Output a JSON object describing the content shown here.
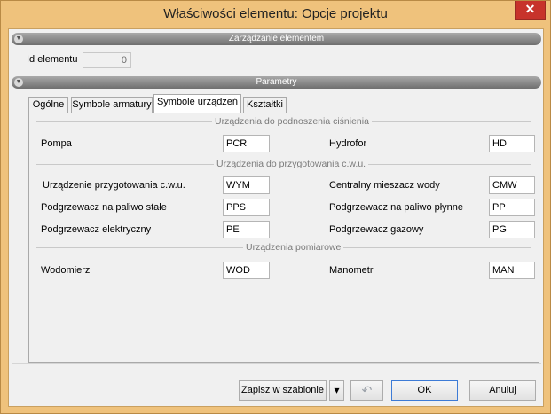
{
  "window": {
    "title": "Właściwości elementu: Opcje projektu",
    "close_label": "✕"
  },
  "sections": {
    "management": "Zarządzanie elementem",
    "parameters": "Parametry"
  },
  "element_id": {
    "label": "Id elementu",
    "value": "0"
  },
  "tabs": [
    {
      "label": "Ogólne"
    },
    {
      "label": "Symbole armatury"
    },
    {
      "label": "Symbole urządzeń"
    },
    {
      "label": "Kształtki"
    }
  ],
  "groups": {
    "pressure": {
      "title": "Urządzenia do podnoszenia ciśnienia",
      "rows": [
        {
          "left_label": "Pompa",
          "left_value": "PCR",
          "right_label": "Hydrofor",
          "right_value": "HD"
        }
      ]
    },
    "hot_water": {
      "title": "Urządzenia do przygotowania c.w.u.",
      "rows": [
        {
          "left_label": "Urządzenie przygotowania c.w.u.",
          "left_value": "WYM",
          "right_label": "Centralny mieszacz wody",
          "right_value": "CMW"
        },
        {
          "left_label": "Podgrzewacz na paliwo stałe",
          "left_value": "PPS",
          "right_label": "Podgrzewacz na paliwo płynne",
          "right_value": "PP"
        },
        {
          "left_label": "Podgrzewacz elektryczny",
          "left_value": "PE",
          "right_label": "Podgrzewacz gazowy",
          "right_value": "PG"
        }
      ]
    },
    "measurement": {
      "title": "Urządzenia pomiarowe",
      "rows": [
        {
          "left_label": "Wodomierz",
          "left_value": "WOD",
          "right_label": "Manometr",
          "right_value": "MAN"
        }
      ]
    }
  },
  "footer": {
    "save_template": "Zapisz w szablonie",
    "dropdown": "▾",
    "undo": "↶",
    "ok": "OK",
    "cancel": "Anuluj"
  }
}
